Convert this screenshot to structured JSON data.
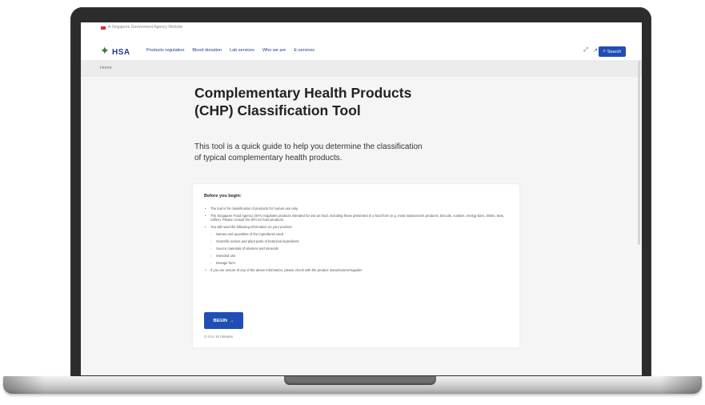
{
  "gov_banner": {
    "text": "A Singapore Government Agency Website"
  },
  "header": {
    "logo_text": "HSA",
    "nav": [
      "Products regulation",
      "Blood donation",
      "Lab services",
      "Who we are",
      "E-services"
    ],
    "search_label": "Search"
  },
  "breadcrumb": {
    "home": "Home"
  },
  "main": {
    "title": "Complementary Health Products (CHP) Classification Tool",
    "subtitle": "This tool is a quick guide to help you determine the classification of typical complementary health products."
  },
  "card": {
    "heading": "Before you begin:",
    "bullets": [
      "The tool is for classification of products for human use only.",
      "The Singapore Food Agency (SFA) regulates products intended for use as food, including those presented in a food form (e.g. meal replacement products, biscuits, cookies, energy bars, drinks, teas, coffee). Please consult the SFA for food products.",
      "You will need the following information on your product:",
      "Names and quantities of the ingredients used",
      "Scientific names and plant parts of botanical ingredients",
      "Source materials of vitamins and minerals",
      "Intended use",
      "Dosage form",
      "If you are unsure of any of the above information, please check with the product manufacturer/supplier."
    ],
    "begin_label": "BEGIN",
    "time_note": "5 to 15 minutes"
  }
}
